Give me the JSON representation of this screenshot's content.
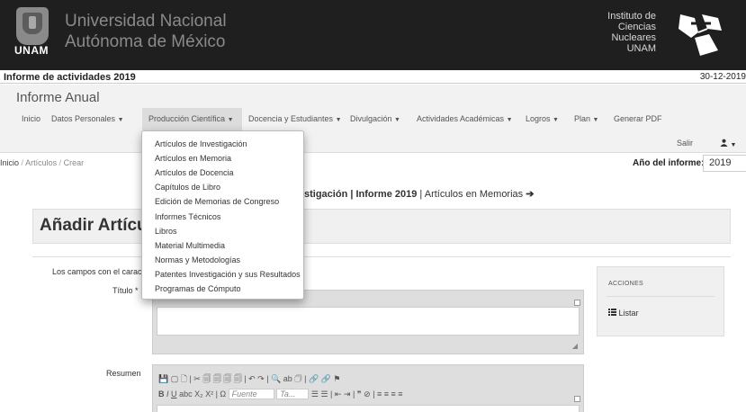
{
  "header": {
    "logo_text": "UNAM",
    "university_line1": "Universidad Nacional",
    "university_line2": "Autónoma de México",
    "institute_lines": [
      "Instituto de",
      "Ciencias",
      "Nucleares",
      "UNAM"
    ]
  },
  "report": {
    "title": "Informe de actividades 2019",
    "date": "30-12-2019"
  },
  "navbar": {
    "brand": "Informe Anual",
    "items": [
      {
        "label": "Inicio",
        "caret": ""
      },
      {
        "label": "Datos Personales",
        "caret": "▼"
      },
      {
        "label": "Producción Científica",
        "caret": "▼"
      },
      {
        "label": "Docencia y Estudiantes",
        "caret": "▼"
      },
      {
        "label": "Divulgación",
        "caret": "▼"
      },
      {
        "label": "Actividades Académicas",
        "caret": "▼"
      },
      {
        "label": "Logros",
        "caret": "▼"
      },
      {
        "label": "Plan",
        "caret": "▼"
      },
      {
        "label": "Generar PDF",
        "caret": ""
      }
    ],
    "logout": "Salir",
    "user_icon": "user-icon",
    "user_caret": "▼"
  },
  "breadcrumb": {
    "home": "Inicio",
    "section": "Artículos",
    "current": "Crear",
    "separator": "/"
  },
  "year_select": {
    "label": "Año del informe:",
    "value": "2019"
  },
  "section_path": {
    "prefix": "stigación | ",
    "report": "Informe 2019",
    "sep": " | ",
    "current": "Artículos en Memorias",
    "arrow": "➔"
  },
  "page": {
    "title": "Añadir Artícu"
  },
  "form": {
    "required_note": "Los campos con el caracte",
    "titulo_label": "Título *",
    "resumen_label": "Resumen",
    "editor_toolbar1": "💾 ▢ 🗋 | ✂ 🗐 🗐 🗐 🗐 | ↶ ↷ | 🔍 ab 🗇 | 🔗 🔗 ⚑",
    "editor_toolbar2_bold": "B",
    "editor_toolbar2_italic": "I",
    "editor_toolbar2_underline": "U",
    "editor_toolbar2_rest": "abc X₂ X² | Ω",
    "font_placeholder": "Fuente",
    "size_placeholder": "Ta...",
    "editor_toolbar2_tail": "☰ ☰ | ⇤ ⇥ | ❞ ⊘ | ≡ ≡ ≡ ≡"
  },
  "actions": {
    "title": "ACCIONES",
    "list_label": "Listar",
    "list_icon": "list-icon"
  },
  "dropdown": {
    "items": [
      "Artículos de Investigación",
      "Artículos en Memoria",
      "Artículos de Docencia",
      "Capítulos de Libro",
      "Edición de Memorias de Congreso",
      "Informes Técnicos",
      "Libros",
      "Material Multimedia",
      "Normas y Metodologías",
      "Patentes Investigación y sus Resultados",
      "Programas de Cómputo"
    ]
  }
}
